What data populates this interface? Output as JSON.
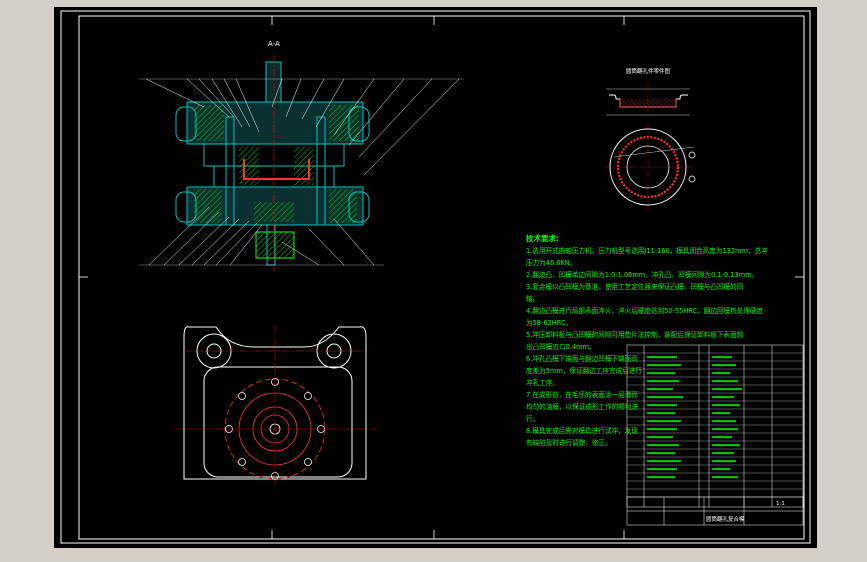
{
  "section_label": "A-A",
  "part_drawing_title": "圆筒翻孔件零件图",
  "technical_requirements": {
    "title": "技术要求:",
    "lines": [
      "1.选用开式曲轴压力机，压力机型号选用J11-160，模具闭合高度为132mm，总冲",
      "压力为46.6KN。",
      "2.翻边凸、凹模单边间隙为1.0-1.06mm，冲孔凸、凹模间隙为0.1-0.13mm。",
      "3.复合模以凸凹模为基准，使用工艺定位器来保证凸模、凹模与凸凹模的同",
      "轴。",
      "4.翻边凸模进行局部表面淬火，淬火后硬度达到50-55HRC，翻边回模热处理硬度",
      "为58-62HRC。",
      "5.冲压卸料板与凸凹模的间隙可用垫片法控制，装配后保证卸料板下表面超",
      "出凸凹模刃口0.4mm。",
      "6.冲孔凸模下端面与翻边凹模下端面高",
      "度差为5mm，保证翻边工序完成后进行",
      "冲孔工序。",
      "7.在成形前，在毛坯的表面涂一层薄而",
      "均匀的油膜，以保证成形工作的顺利进",
      "行。",
      "8.模具完成后需对模具进行试冲，发现",
      "有缺陷及时进行调整、修正。"
    ]
  },
  "title_block": {
    "drawing_name": "圆筒翻孔复合模",
    "scale": "1:1"
  },
  "colors": {
    "background": "#000000",
    "frame": "#ffffff",
    "section": "#00c0c0",
    "hatch": "#00ff00",
    "center_line": "#ff0000",
    "text": "#00ff00",
    "leader": "#ffffff"
  }
}
